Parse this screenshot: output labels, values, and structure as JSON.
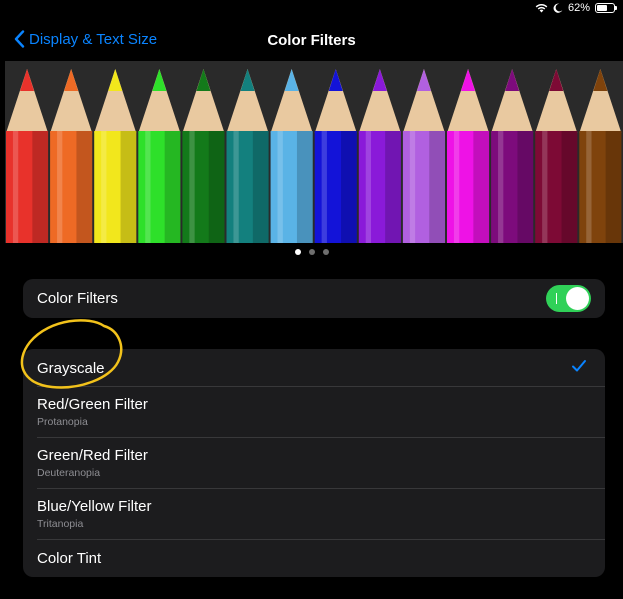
{
  "status_bar": {
    "battery_text": "62%",
    "battery_level": 0.62,
    "icons": [
      "wifi-icon",
      "moon-icon",
      "battery-icon"
    ]
  },
  "nav": {
    "back_label": "Display & Text Size",
    "title": "Color Filters"
  },
  "carousel": {
    "pencil_colors": [
      "#e8322b",
      "#ee6a25",
      "#f2e71c",
      "#2ee02a",
      "#137a1a",
      "#13807e",
      "#5ab3e6",
      "#1313d8",
      "#8a1ad9",
      "#b160e0",
      "#ee12e6",
      "#7d0b7c",
      "#7d0a35",
      "#7f430c"
    ],
    "page_count": 3,
    "active_page": 0
  },
  "color_filters_toggle": {
    "label": "Color Filters",
    "on": true
  },
  "filters": [
    {
      "title": "Grayscale",
      "subtitle": "",
      "selected": true
    },
    {
      "title": "Red/Green Filter",
      "subtitle": "Protanopia",
      "selected": false
    },
    {
      "title": "Green/Red Filter",
      "subtitle": "Deuteranopia",
      "selected": false
    },
    {
      "title": "Blue/Yellow Filter",
      "subtitle": "Tritanopia",
      "selected": false
    },
    {
      "title": "Color Tint",
      "subtitle": "",
      "selected": false
    }
  ],
  "colors": {
    "accent": "#0a84ff",
    "toggle_on": "#30d158",
    "annotation": "#f2c21b",
    "cell_bg": "#1c1c1e"
  }
}
